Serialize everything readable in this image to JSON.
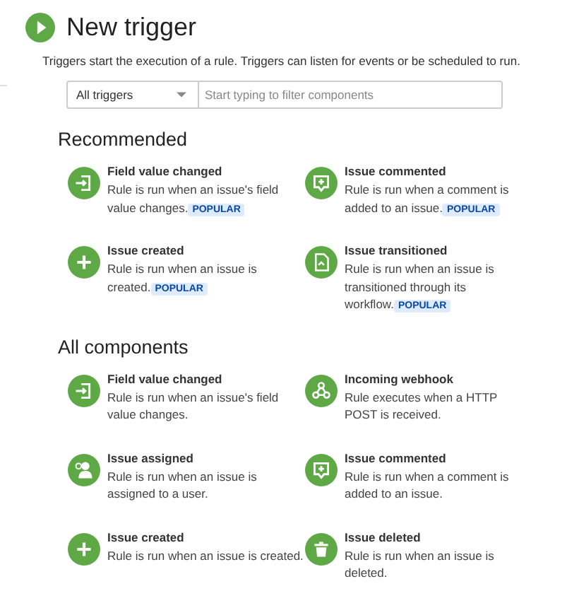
{
  "header": {
    "title": "New trigger",
    "description": "Triggers start the execution of a rule. Triggers can listen for events or be scheduled to run."
  },
  "filter": {
    "dropdown": "All triggers",
    "placeholder": "Start typing to filter components"
  },
  "sections": [
    {
      "heading": "Recommended",
      "items": [
        {
          "kind": "field",
          "title": "Field value changed",
          "description": "Rule is run when an issue's field value changes.",
          "badge": "POPULAR"
        },
        {
          "kind": "comment",
          "title": "Issue commented",
          "description": "Rule is run when a comment is added to an issue.",
          "badge": "POPULAR"
        },
        {
          "kind": "plus",
          "title": "Issue created",
          "description": "Rule is run when an issue is created.",
          "badge": "POPULAR"
        },
        {
          "kind": "transition",
          "title": "Issue transitioned",
          "description": "Rule is run when an issue is transitioned through its workflow.",
          "badge": "POPULAR"
        }
      ]
    },
    {
      "heading": "All components",
      "items": [
        {
          "kind": "field",
          "title": "Field value changed",
          "description": "Rule is run when an issue's field value changes."
        },
        {
          "kind": "webhook",
          "title": "Incoming webhook",
          "description": "Rule executes when a HTTP POST is received."
        },
        {
          "kind": "user",
          "title": "Issue assigned",
          "description": "Rule is run when an issue is assigned to a user."
        },
        {
          "kind": "comment",
          "title": "Issue commented",
          "description": "Rule is run when a comment is added to an issue."
        },
        {
          "kind": "plus",
          "title": "Issue created",
          "description": "Rule is run when an issue is created."
        },
        {
          "kind": "trash",
          "title": "Issue deleted",
          "description": "Rule is run when an issue is deleted."
        }
      ]
    }
  ]
}
